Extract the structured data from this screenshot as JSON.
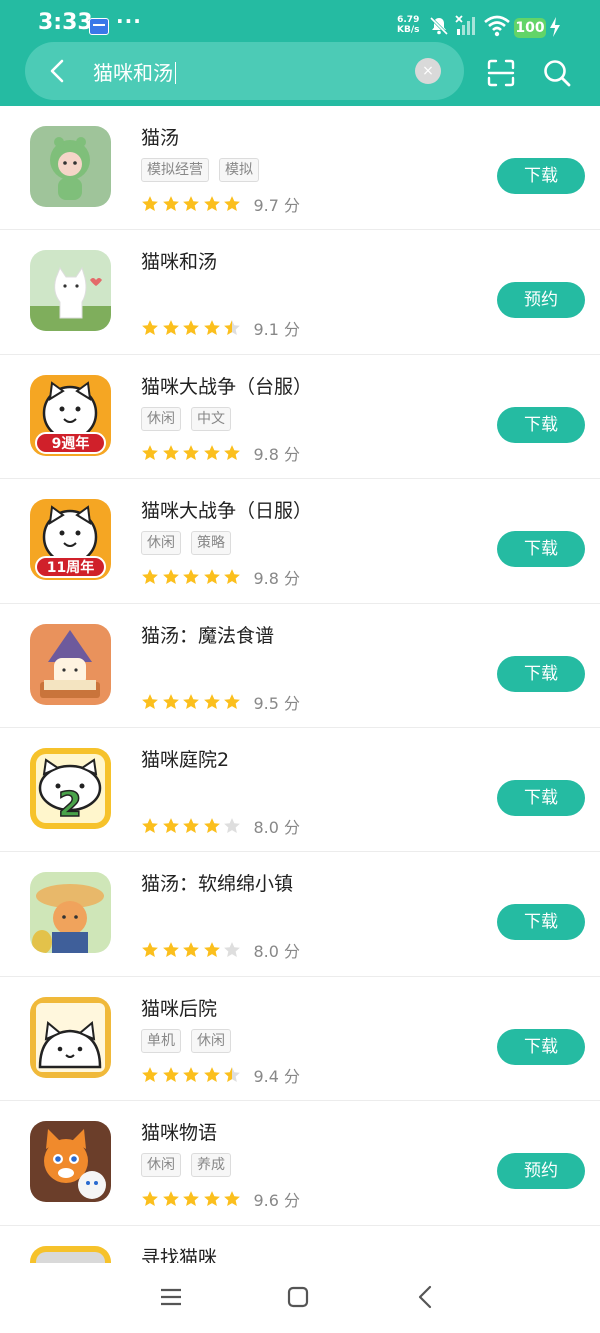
{
  "status_bar": {
    "time": "3:33",
    "speed_value": "6.79",
    "speed_unit": "KB/s",
    "battery": "100"
  },
  "search": {
    "query": "猫咪和汤",
    "clear_glyph": "×"
  },
  "colors": {
    "accent": "#25bba2",
    "star_on": "#fbbf1d",
    "star_off": "#dedede"
  },
  "results": [
    {
      "name": "猫汤",
      "tags": [
        "模拟经营",
        "模拟"
      ],
      "stars": 5,
      "score": "9.7 分",
      "action": "下载"
    },
    {
      "name": "猫咪和汤",
      "tags": [],
      "stars": 4.5,
      "score": "9.1 分",
      "action": "预约"
    },
    {
      "name": "猫咪大战争（台服）",
      "tags": [
        "休闲",
        "中文"
      ],
      "stars": 5,
      "score": "9.8 分",
      "action": "下载"
    },
    {
      "name": "猫咪大战争（日服）",
      "tags": [
        "休闲",
        "策略"
      ],
      "stars": 5,
      "score": "9.8 分",
      "action": "下载"
    },
    {
      "name": "猫汤：魔法食谱",
      "tags": [],
      "stars": 5,
      "score": "9.5 分",
      "action": "下载"
    },
    {
      "name": "猫咪庭院2",
      "tags": [],
      "stars": 4,
      "score": "8.0 分",
      "action": "下载"
    },
    {
      "name": "猫汤：软绵绵小镇",
      "tags": [],
      "stars": 4,
      "score": "8.0 分",
      "action": "下载"
    },
    {
      "name": "猫咪后院",
      "tags": [
        "单机",
        "休闲"
      ],
      "stars": 4.5,
      "score": "9.4 分",
      "action": "下载"
    },
    {
      "name": "猫咪物语",
      "tags": [
        "休闲",
        "养成"
      ],
      "stars": 5,
      "score": "9.6 分",
      "action": "预约"
    },
    {
      "name": "寻找猫咪",
      "tags": [],
      "stars": 0,
      "score": "",
      "action": ""
    }
  ],
  "icon_art": [
    {
      "bg": "#9fc49a",
      "label": "",
      "label_bg": ""
    },
    {
      "bg": "#cfe6c8",
      "label": "",
      "label_bg": ""
    },
    {
      "bg": "#f5a623",
      "label": "9週年",
      "label_bg": "#d0202a"
    },
    {
      "bg": "#f5a623",
      "label": "11周年",
      "label_bg": "#d0202a"
    },
    {
      "bg": "#e9925c",
      "label": "",
      "label_bg": ""
    },
    {
      "bg": "#f6c22b",
      "label": "",
      "label_bg": ""
    },
    {
      "bg": "#cfe6b8",
      "label": "",
      "label_bg": ""
    },
    {
      "bg": "#f0b93a",
      "label": "",
      "label_bg": ""
    },
    {
      "bg": "#6b3e2a",
      "label": "",
      "label_bg": ""
    },
    {
      "bg": "#f6c22b",
      "label": "",
      "label_bg": ""
    }
  ],
  "icons": {
    "back": "back-arrow-icon",
    "scan": "scan-icon",
    "search": "search-icon",
    "nav_menu": "menu-icon",
    "nav_home": "home-icon",
    "nav_back": "back-icon"
  }
}
